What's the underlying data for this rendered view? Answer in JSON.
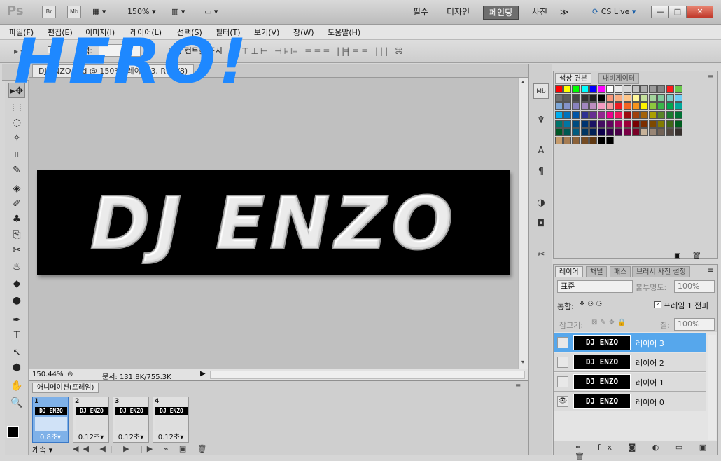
{
  "app": {
    "logo": "Ps",
    "bridge_btn": "Br",
    "minibridge_btn": "Mb",
    "zoom_select": "150%",
    "workspaces": [
      "필수",
      "디자인",
      "페인팅",
      "사진"
    ],
    "active_workspace": "페인팅",
    "more": "≫",
    "cs_live": "CS Live",
    "win_min": "—",
    "win_max": "□",
    "win_close": "✕"
  },
  "menu": [
    "파일(F)",
    "편집(E)",
    "이미지(I)",
    "레이어(L)",
    "선택(S)",
    "필터(T)",
    "보기(V)",
    "창(W)",
    "도움말(H)"
  ],
  "options": {
    "auto_select": "선택:",
    "transform_controls": "변형 컨트롤 표시",
    "align_icons": "⊤⊥⊢ ⊣⊧⊫ ≡≡≡ |||"
  },
  "overlay_text": "HERO!",
  "document": {
    "tab_label": "DJ ENZO.psd @ 150% (레이어 3, RGB/8)",
    "art_text": "DJ ENZO",
    "zoom": "150.44%",
    "doc_size": "문서: 131.8K/755.3K"
  },
  "animation": {
    "title": "애니메이션(프레임)",
    "frames": [
      {
        "num": "1",
        "delay": "0.8초▾",
        "thumb": "DJ ENZO"
      },
      {
        "num": "2",
        "delay": "0.12초▾",
        "thumb": "DJ ENZO"
      },
      {
        "num": "3",
        "delay": "0.12초▾",
        "thumb": "DJ ENZO"
      },
      {
        "num": "4",
        "delay": "0.12초▾",
        "thumb": "DJ ENZO"
      }
    ],
    "loop": "계속 ▾",
    "controls": "◀◀ ◀| ▶ |▶ ⌁ ▣ 🗑"
  },
  "swatch_panel": {
    "tabs": [
      "색상 견본",
      "내비게이터"
    ],
    "colors": [
      "#ff0000",
      "#ffff00",
      "#00ff00",
      "#00ffff",
      "#0000ff",
      "#ff00ff",
      "#ffffff",
      "#ebebeb",
      "#d6d6d6",
      "#c2c2c2",
      "#adadad",
      "#999999",
      "#858585",
      "#ff1a1a",
      "#6ac94c",
      "#707070",
      "#5c5c5c",
      "#474747",
      "#333333",
      "#1f1f1f",
      "#000000",
      "#f7977a",
      "#f9ad81",
      "#fdc68a",
      "#fff79a",
      "#c4df9b",
      "#a3d39c",
      "#82ca9d",
      "#7bcdc8",
      "#6ecff6",
      "#7ea7d8",
      "#8493ca",
      "#8882be",
      "#a187be",
      "#bc8dbf",
      "#f49ac2",
      "#f6989d",
      "#ed1c24",
      "#f26522",
      "#f7941d",
      "#fff200",
      "#8dc73f",
      "#39b54a",
      "#00a651",
      "#00a99d",
      "#00aeef",
      "#0072bc",
      "#0054a6",
      "#2e3192",
      "#662d91",
      "#92278f",
      "#ec008c",
      "#ed145b",
      "#9e0b0f",
      "#a0410d",
      "#a36209",
      "#aba000",
      "#598527",
      "#197b30",
      "#007236",
      "#00746b",
      "#0076a3",
      "#004b80",
      "#003471",
      "#1b1464",
      "#440e62",
      "#630460",
      "#9e005d",
      "#9e0039",
      "#790000",
      "#7b2e00",
      "#7d4900",
      "#827b00",
      "#406618",
      "#005e20",
      "#005826",
      "#005952",
      "#005b7f",
      "#003663",
      "#002157",
      "#0d004c",
      "#32004b",
      "#4b0049",
      "#7b0046",
      "#7a0026",
      "#c7b299",
      "#998675",
      "#736357",
      "#534741",
      "#37302d",
      "#c69c6d",
      "#a67c52",
      "#8c6239",
      "#754c24",
      "#603913",
      "#000000",
      "#000000"
    ]
  },
  "layers_panel": {
    "tabs": [
      "레이어",
      "채널",
      "패스",
      "브러시 사전 설정"
    ],
    "blend_mode": "표준",
    "opacity_label": "불투명도:",
    "opacity_value": "100%",
    "unify_label": "통합:",
    "propagate_label": "프레임 1 전파",
    "lock_label": "잠그기:",
    "fill_label": "칠:",
    "fill_value": "100%",
    "layers": [
      {
        "name": "레이어 3",
        "thumb": "DJ ENZO",
        "selected": true,
        "visible": false
      },
      {
        "name": "레이어 2",
        "thumb": "DJ ENZO",
        "selected": false,
        "visible": false
      },
      {
        "name": "레이어 1",
        "thumb": "DJ ENZO",
        "selected": false,
        "visible": false
      },
      {
        "name": "레이어 0",
        "thumb": "DJ ENZO",
        "selected": false,
        "visible": true
      }
    ],
    "bottom_icons": "⚭ fx ◙ ◐ ▭ ▣ 🗑",
    "eye_glyph": "👁"
  },
  "tools": [
    "▸✥",
    "⬚",
    "◌",
    "✧",
    "⌗",
    "✎",
    "◈",
    "✐",
    "♣",
    "⎘",
    "✂",
    "♨",
    "◆",
    "●",
    "✒",
    "T",
    "↖",
    "⬢",
    "✋",
    "🔍"
  ],
  "dock_icons": [
    "Mb",
    "♆",
    "A",
    "¶",
    "◑",
    "◘",
    "✂"
  ]
}
